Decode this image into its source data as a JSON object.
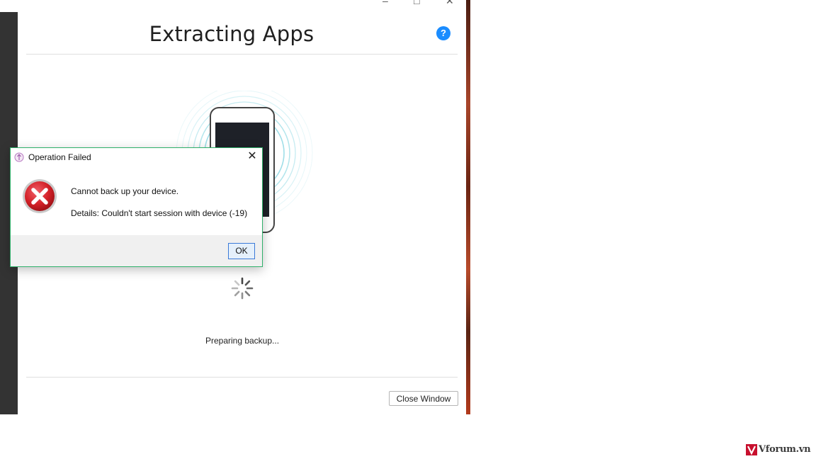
{
  "window": {
    "title": "Extracting Apps",
    "controls": {
      "minimize": "–",
      "maximize": "□",
      "close": "✕"
    },
    "help_icon_glyph": "?",
    "status_text": "Preparing backup...",
    "close_button_label": "Close Window"
  },
  "dialog": {
    "title": "Operation Failed",
    "message": "Cannot back up your device.",
    "details": "Details: Couldn't start session with device (-19)",
    "ok_label": "OK",
    "close_glyph": "✕",
    "icon": "error-icon"
  },
  "watermark": {
    "text": "Vforum.vn"
  },
  "colors": {
    "accent": "#1a8cff",
    "error_red": "#d32027",
    "dialog_border": "#2fb06a",
    "ripple": "#7fd3e0"
  }
}
